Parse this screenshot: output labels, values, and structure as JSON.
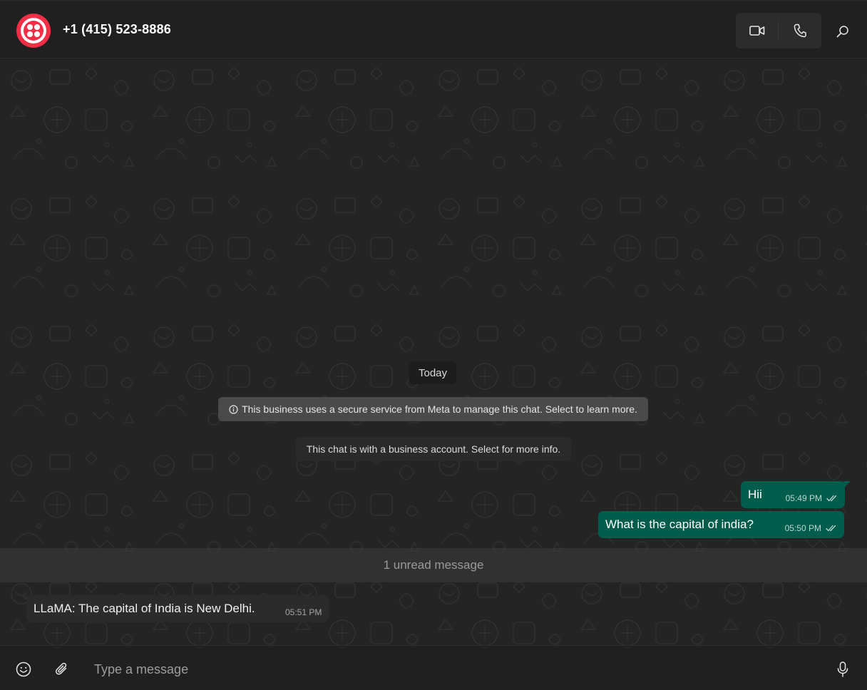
{
  "header": {
    "title": "+1 (415) 523-8886",
    "avatar_color": "#f22f46",
    "icons": [
      "video-call-icon",
      "voice-call-icon",
      "search-icon"
    ]
  },
  "chat": {
    "date_chip": "Today",
    "notices": [
      "This business uses a secure service from Meta to manage this chat. Select to learn more.",
      "This chat is with a business account. Select for more info."
    ],
    "messages_out": [
      {
        "text": "Hii",
        "time": "05:49 PM",
        "status": "read"
      },
      {
        "text": "What is the capital of india?",
        "time": "05:50 PM",
        "status": "read"
      }
    ],
    "unread_label": "1 unread message",
    "messages_in": [
      {
        "text": "LLaMA: The capital of India is New Delhi.",
        "time": "05:51 PM"
      }
    ],
    "outgoing_bubble_color": "#005c4b"
  },
  "composer": {
    "placeholder": "Type a message",
    "icons": [
      "emoji-icon",
      "attach-icon",
      "microphone-icon"
    ]
  }
}
